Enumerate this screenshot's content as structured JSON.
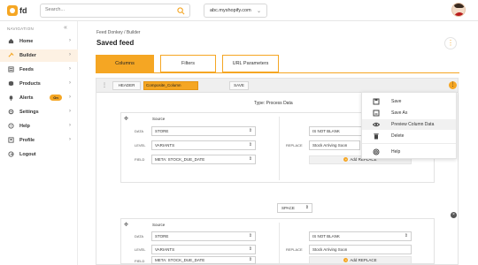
{
  "brand": {
    "text": "fd",
    "accent": "#f5a623"
  },
  "topbar": {
    "search_placeholder": "Search...",
    "store_value": "abc.myshopify.com"
  },
  "sidebar": {
    "heading": "NAVIGATION",
    "collapse": "«",
    "items": [
      {
        "label": "Home",
        "icon": "home-icon"
      },
      {
        "label": "Builder",
        "icon": "builder-icon",
        "active": true
      },
      {
        "label": "Feeds",
        "icon": "feeds-icon"
      },
      {
        "label": "Products",
        "icon": "products-icon"
      },
      {
        "label": "Alerts",
        "icon": "alerts-icon",
        "badge": "On"
      },
      {
        "label": "Settings",
        "icon": "gear-icon"
      },
      {
        "label": "Help",
        "icon": "help-icon"
      },
      {
        "label": "Profile",
        "icon": "profile-icon"
      },
      {
        "label": "Logout",
        "icon": "logout-icon"
      }
    ]
  },
  "main": {
    "breadcrumb": "Feed Donkey  /  Builder",
    "title": "Saved feed",
    "tabs": [
      "Columns",
      "Filters",
      "URL Parameters"
    ],
    "panel": {
      "header_btn": "HEADER",
      "column_name": "Composite_Column",
      "save_btn": "SAVE",
      "type_label": "Type: Process Data",
      "space_value": "SPACE",
      "blocks": [
        {
          "source_heading": "Source",
          "data_label": "DATA",
          "data_value": "STORE",
          "level_label": "LEVEL",
          "level_value": "VARIANTS",
          "field_label": "FIELD",
          "field_value": "META: STOCK_DUE_DATE",
          "condition_value": "IS NOT BLANK",
          "replace_label": "REPLACE",
          "replace_value": "Stock Arriving Soon",
          "add_replace": "Add REPLACE"
        },
        {
          "source_heading": "Source",
          "data_label": "DATA",
          "data_value": "STORE",
          "level_label": "LEVEL",
          "level_value": "VARIANTS",
          "field_label": "FIELD",
          "field_value": "META: STOCK_DUE_DATE",
          "condition_value": "IS NOT BLANK",
          "replace_label": "REPLACE",
          "replace_value": "Stock Arriving Soon",
          "add_replace": "Add REPLACE"
        }
      ]
    }
  },
  "menu": {
    "items": [
      {
        "label": "Save",
        "icon": "save-icon"
      },
      {
        "label": "Save As",
        "icon": "save-as-icon"
      },
      {
        "label": "Preview Column Data",
        "icon": "eye-icon",
        "highlighted": true
      },
      {
        "label": "Delete",
        "icon": "trash-icon"
      },
      {
        "label": "Help",
        "icon": "help-icon"
      }
    ]
  }
}
